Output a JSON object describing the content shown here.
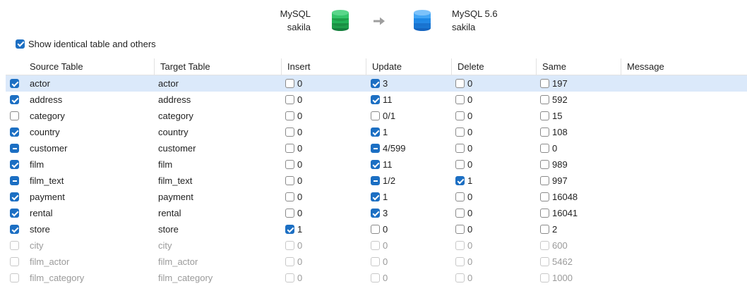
{
  "header": {
    "source": {
      "type": "MySQL",
      "name": "sakila",
      "color": "#1e9e4a"
    },
    "target": {
      "type": "MySQL 5.6",
      "name": "sakila",
      "color": "#1e88e5"
    },
    "arrow_icon": "arrow-right-icon"
  },
  "options": {
    "show_identical_label": "Show identical table and others",
    "show_identical_checked": true
  },
  "columns": [
    "Source Table",
    "Target Table",
    "Insert",
    "Update",
    "Delete",
    "Same",
    "Message"
  ],
  "rows": [
    {
      "state": "checked",
      "source": "actor",
      "target": "actor",
      "insert": {
        "state": "empty",
        "val": "0"
      },
      "update": {
        "state": "checked",
        "val": "3"
      },
      "delete": {
        "state": "empty",
        "val": "0"
      },
      "same": {
        "state": "empty",
        "val": "197"
      },
      "message": "",
      "selected": true
    },
    {
      "state": "checked",
      "source": "address",
      "target": "address",
      "insert": {
        "state": "empty",
        "val": "0"
      },
      "update": {
        "state": "checked",
        "val": "11"
      },
      "delete": {
        "state": "empty",
        "val": "0"
      },
      "same": {
        "state": "empty",
        "val": "592"
      },
      "message": ""
    },
    {
      "state": "empty",
      "source": "category",
      "target": "category",
      "insert": {
        "state": "empty",
        "val": "0"
      },
      "update": {
        "state": "empty",
        "val": "0/1"
      },
      "delete": {
        "state": "empty",
        "val": "0"
      },
      "same": {
        "state": "empty",
        "val": "15"
      },
      "message": ""
    },
    {
      "state": "checked",
      "source": "country",
      "target": "country",
      "insert": {
        "state": "empty",
        "val": "0"
      },
      "update": {
        "state": "checked",
        "val": "1"
      },
      "delete": {
        "state": "empty",
        "val": "0"
      },
      "same": {
        "state": "empty",
        "val": "108"
      },
      "message": ""
    },
    {
      "state": "partial",
      "source": "customer",
      "target": "customer",
      "insert": {
        "state": "empty",
        "val": "0"
      },
      "update": {
        "state": "partial",
        "val": "4/599"
      },
      "delete": {
        "state": "empty",
        "val": "0"
      },
      "same": {
        "state": "empty",
        "val": "0"
      },
      "message": ""
    },
    {
      "state": "checked",
      "source": "film",
      "target": "film",
      "insert": {
        "state": "empty",
        "val": "0"
      },
      "update": {
        "state": "checked",
        "val": "11"
      },
      "delete": {
        "state": "empty",
        "val": "0"
      },
      "same": {
        "state": "empty",
        "val": "989"
      },
      "message": ""
    },
    {
      "state": "partial",
      "source": "film_text",
      "target": "film_text",
      "insert": {
        "state": "empty",
        "val": "0"
      },
      "update": {
        "state": "partial",
        "val": "1/2"
      },
      "delete": {
        "state": "checked",
        "val": "1"
      },
      "same": {
        "state": "empty",
        "val": "997"
      },
      "message": ""
    },
    {
      "state": "checked",
      "source": "payment",
      "target": "payment",
      "insert": {
        "state": "empty",
        "val": "0"
      },
      "update": {
        "state": "checked",
        "val": "1"
      },
      "delete": {
        "state": "empty",
        "val": "0"
      },
      "same": {
        "state": "empty",
        "val": "16048"
      },
      "message": ""
    },
    {
      "state": "checked",
      "source": "rental",
      "target": "rental",
      "insert": {
        "state": "empty",
        "val": "0"
      },
      "update": {
        "state": "checked",
        "val": "3"
      },
      "delete": {
        "state": "empty",
        "val": "0"
      },
      "same": {
        "state": "empty",
        "val": "16041"
      },
      "message": ""
    },
    {
      "state": "checked",
      "source": "store",
      "target": "store",
      "insert": {
        "state": "checked",
        "val": "1"
      },
      "update": {
        "state": "empty",
        "val": "0"
      },
      "delete": {
        "state": "empty",
        "val": "0"
      },
      "same": {
        "state": "empty",
        "val": "2"
      },
      "message": ""
    },
    {
      "state": "disabled",
      "source": "city",
      "target": "city",
      "insert": {
        "state": "disabled",
        "val": "0"
      },
      "update": {
        "state": "disabled",
        "val": "0"
      },
      "delete": {
        "state": "disabled",
        "val": "0"
      },
      "same": {
        "state": "disabled",
        "val": "600"
      },
      "message": "",
      "dim": true
    },
    {
      "state": "disabled",
      "source": "film_actor",
      "target": "film_actor",
      "insert": {
        "state": "disabled",
        "val": "0"
      },
      "update": {
        "state": "disabled",
        "val": "0"
      },
      "delete": {
        "state": "disabled",
        "val": "0"
      },
      "same": {
        "state": "disabled",
        "val": "5462"
      },
      "message": "",
      "dim": true
    },
    {
      "state": "disabled",
      "source": "film_category",
      "target": "film_category",
      "insert": {
        "state": "disabled",
        "val": "0"
      },
      "update": {
        "state": "disabled",
        "val": "0"
      },
      "delete": {
        "state": "disabled",
        "val": "0"
      },
      "same": {
        "state": "disabled",
        "val": "1000"
      },
      "message": "",
      "dim": true
    }
  ]
}
